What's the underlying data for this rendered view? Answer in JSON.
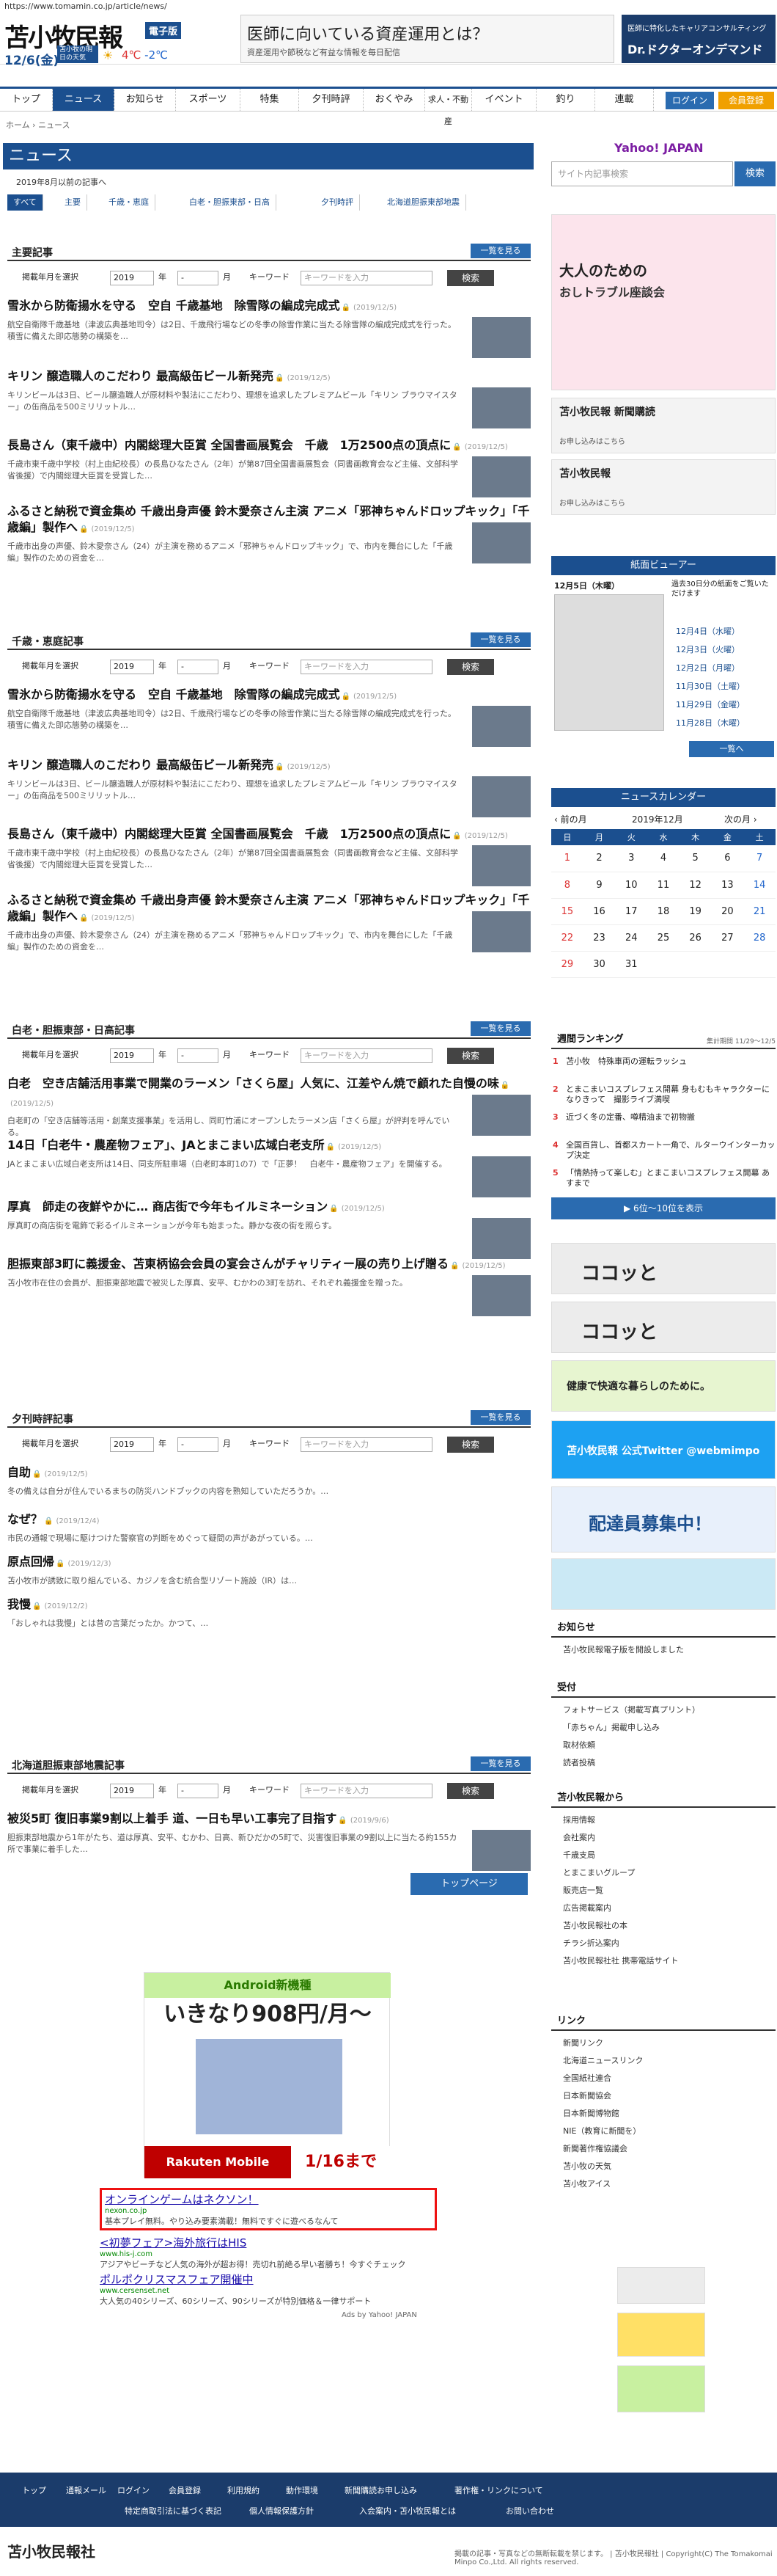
{
  "url": "https://www.tomamin.co.jp/article/news/",
  "header": {
    "logo": "苫小牧民報",
    "logo_tag": "電子版",
    "date": "12/6(金)",
    "weather_label": "苫小牧の明日の天気",
    "temp_hi": "4℃",
    "temp_lo": "-2℃",
    "ad_title": "医師に向いている資産運用とは？",
    "ad_sub": "資産運用や節税など有益な情報を毎日配信",
    "side_ad_1": "医師に特化したキャリアコンサルティング",
    "side_ad_2": "Dr.ドクターオンデマンド"
  },
  "nav": {
    "items": [
      "トップ",
      "ニュース",
      "お知らせ",
      "スポーツ",
      "特集",
      "夕刊時評",
      "おくやみ",
      "求人・不動産",
      "イベント",
      "釣り",
      "連載"
    ],
    "login": "ログイン",
    "member": "会員登録"
  },
  "breadcrumb": "ホーム › ニュース",
  "main": {
    "title": "ニュース",
    "archive": "2019年8月以前の記事へ",
    "tabs": [
      "すべて",
      "主要",
      "千歳・恵庭",
      "白老・胆振東部・日高",
      "夕刊時評",
      "北海道胆振東部地震"
    ],
    "filter": {
      "label": "掲載年月を選択",
      "year": "2019",
      "year_u": "年",
      "month": "-",
      "month_u": "月",
      "kw_label": "キーワード",
      "kw_ph": "キーワードを入力",
      "go": "検索"
    },
    "more": "一覧を見る",
    "sections": [
      {
        "title": "主要記事",
        "articles": [
          {
            "h": "雪氷から防衛揚水を守る　空自 千歳基地　除雪隊の編成完成式",
            "d": "(2019/12/5)",
            "s": "航空自衛隊千歳基地（津波広典基地司令）は2日、千歳飛行場などの冬季の除雪作業に当たる除雪隊の編成完成式を行った。積雪に備えた即応態勢の構築を…"
          },
          {
            "h": "キリン 醸造職人のこだわり 最高級缶ビール新発売",
            "d": "(2019/12/5)",
            "s": "キリンビールは3日、ビール醸造職人が原材料や製法にこだわり、理想を追求したプレミアムビール「キリン ブラウマイスター」の缶商品を500ミリリットル…"
          },
          {
            "h": "長島さん（東千歳中）内閣総理大臣賞 全国書画展覧会　千歳　1万2500点の頂点に",
            "d": "(2019/12/5)",
            "s": "千歳市東千歳中学校（村上由紀校長）の長島ひなたさん（2年）が第87回全国書画展覧会（同書画教育会など主催、文部科学省後援）で内閣総理大臣賞を受賞した…"
          },
          {
            "h": "ふるさと納税で資金集め 千歳出身声優 鈴木愛奈さん主演 アニメ「邪神ちゃんドロップキック」「千歳編」製作へ",
            "d": "(2019/12/5)",
            "s": "千歳市出身の声優、鈴木愛奈さん（24）が主演を務めるアニメ「邪神ちゃんドロップキック」で、市内を舞台にした「千歳編」製作のための資金を…"
          }
        ]
      },
      {
        "title": "千歳・恵庭記事",
        "articles": [
          {
            "h": "雪氷から防衛揚水を守る　空自 千歳基地　除雪隊の編成完成式",
            "d": "(2019/12/5)",
            "s": "航空自衛隊千歳基地（津波広典基地司令）は2日、千歳飛行場などの冬季の除雪作業に当たる除雪隊の編成完成式を行った。積雪に備えた即応態勢の構築を…"
          },
          {
            "h": "キリン 醸造職人のこだわり 最高級缶ビール新発売",
            "d": "(2019/12/5)",
            "s": "キリンビールは3日、ビール醸造職人が原材料や製法にこだわり、理想を追求したプレミアムビール「キリン ブラウマイスター」の缶商品を500ミリリットル…"
          },
          {
            "h": "長島さん（東千歳中）内閣総理大臣賞 全国書画展覧会　千歳　1万2500点の頂点に",
            "d": "(2019/12/5)",
            "s": "千歳市東千歳中学校（村上由紀校長）の長島ひなたさん（2年）が第87回全国書画展覧会（同書画教育会など主催、文部科学省後援）で内閣総理大臣賞を受賞した…"
          },
          {
            "h": "ふるさと納税で資金集め 千歳出身声優 鈴木愛奈さん主演 アニメ「邪神ちゃんドロップキック」「千歳編」製作へ",
            "d": "(2019/12/5)",
            "s": "千歳市出身の声優、鈴木愛奈さん（24）が主演を務めるアニメ「邪神ちゃんドロップキック」で、市内を舞台にした「千歳編」製作のための資金を…"
          }
        ]
      },
      {
        "title": "白老・胆振東部・日高記事",
        "articles": [
          {
            "h": "白老　空き店舗活用事業で開業のラーメン「さくら屋」人気に、江差やん焼で顧れた自慢の味",
            "d": "(2019/12/5)",
            "s": "白老町の「空き店舗等活用・創業支援事業」を活用し、同町竹浦にオープンしたラーメン店「さくら屋」が評判を呼んでいる。"
          },
          {
            "h": "14日「白老牛・農産物フェア」、JAとまこまい広域白老支所",
            "d": "(2019/12/5)",
            "s": "JAとまこまい広域白老支所は14日、同支所駐車場（白老町本町1の7）で「正夢！　白老牛・農産物フェア」を開催する。"
          },
          {
            "h": "厚真　師走の夜鮮やかに… 商店街で今年もイルミネーション",
            "d": "(2019/12/5)",
            "s": "厚真町の商店街を電飾で彩るイルミネーションが今年も始まった。静かな夜の街を照らす。"
          },
          {
            "h": "胆振東部3町に義援金、苫東柄協会会員の宴会さんがチャリティー展の売り上げ贈る",
            "d": "(2019/12/5)",
            "s": "苫小牧市在住の会員が、胆振東部地震で被災した厚真、安平、むかわの3町を訪れ、それぞれ義援金を贈った。"
          }
        ]
      },
      {
        "title": "夕刊時評記事",
        "articles": [
          {
            "h": "自助",
            "d": "(2019/12/5)",
            "s": "冬の備えは自分が住んでいるまちの防災ハンドブックの内容を熟知していただろうか。…"
          },
          {
            "h": "なぜ？",
            "d": "(2019/12/4)",
            "s": "市民の通報で現場に駆けつけた警察官の判断をめぐって疑問の声があがっている。…"
          },
          {
            "h": "原点回帰",
            "d": "(2019/12/3)",
            "s": "苫小牧市が誘致に取り組んでいる、カジノを含む統合型リゾート施設（IR）は…"
          },
          {
            "h": "我慢",
            "d": "(2019/12/2)",
            "s": "「おしゃれは我慢」とは昔の言葉だったか。かつて、…"
          }
        ]
      },
      {
        "title": "北海道胆振東部地震記事",
        "articles": [
          {
            "h": "被災5町 復旧事業9割以上着手 道、一日も早い工事完了目指す",
            "d": "(2019/9/6)",
            "s": "胆振東部地震から1年がたち、道は厚真、安平、むかわ、日高、新ひだかの5町で、災害復旧事業の9割以上に当たる約155カ所で事業に着手した…"
          }
        ]
      }
    ],
    "top_btn": "トップページ"
  },
  "sidebar": {
    "yahoo": "Yahoo! JAPAN",
    "search_ph": "サイト内記事検索",
    "search_btn": "検索",
    "promo1": {
      "t1": "大人のための",
      "t2": "おしトラブル座談会"
    },
    "promo2": {
      "t1": "苫小牧民報 新聞購読",
      "t2": "お申し込みはこちら"
    },
    "promo3": {
      "t1": "苫小牧民報",
      "t2": "お申し込みはこちら"
    },
    "viewer": {
      "head": "紙面ビューアー",
      "date": "12月5日（木曜）",
      "note": "過去30日分の紙面をご覧いただけます",
      "dates": [
        "12月4日（水曜）",
        "12月3日（火曜）",
        "12月2日（月曜）",
        "11月30日（土曜）",
        "11月29日（金曜）",
        "11月28日（木曜）"
      ],
      "btn": "一覧へ"
    },
    "calendar": {
      "head": "ニュースカレンダー",
      "prev": "‹ 前の月",
      "title": "2019年12月",
      "next": "次の月 ›",
      "dow": [
        "日",
        "月",
        "火",
        "水",
        "木",
        "金",
        "土"
      ],
      "weeks": [
        [
          "1",
          "2",
          "3",
          "4",
          "5",
          "6",
          "7"
        ],
        [
          "8",
          "9",
          "10",
          "11",
          "12",
          "13",
          "14"
        ],
        [
          "15",
          "16",
          "17",
          "18",
          "19",
          "20",
          "21"
        ],
        [
          "22",
          "23",
          "24",
          "25",
          "26",
          "27",
          "28"
        ],
        [
          "29",
          "30",
          "31",
          "",
          "",
          "",
          "",
          ""
        ]
      ]
    },
    "ranking": {
      "head": "週間ランキング",
      "period": "集計期間 11/29〜12/5",
      "items": [
        "苫小牧　特殊車両の運転ラッシュ",
        "とまこまいコスプレフェス開幕 身もむもキャラクターになりきって　撮影ライブ満喫",
        "近づく冬の定番、噂精油まで初物搬",
        "全国百貨し、首都スカート一角で、ルターウインターカップ決定",
        "「情熱持って楽しむ」とまこまいコスプレフェス開幕 あすまで"
      ],
      "more": "▶ 6位〜10位を表示"
    },
    "ad_cocotto": "ココッと",
    "ad_medical": "健康で快適な暮らしのために。",
    "twitter": "苫小牧民報 公式Twitter @webmimpo",
    "recruit": "配達員募集中！",
    "info_head": "お知らせ",
    "info_items": [
      "苫小牧民報電子版を開設しました"
    ],
    "accept_head": "受付",
    "accept_items": [
      "フォトサービス（掲載写真プリント）",
      "「赤ちゃん」掲載申し込み",
      "取材依頼",
      "読者投稿"
    ],
    "from_head": "苫小牧民報から",
    "from_items": [
      "採用情報",
      "会社案内",
      "千歳支局",
      "とまこまいグループ",
      "販売店一覧",
      "広告掲載案内",
      "苫小牧民報社の本",
      "チラシ折込案内",
      "苫小牧民報社社 携帯電話サイト"
    ],
    "link_head": "リンク",
    "link_items": [
      "新聞リンク",
      "北海道ニュースリンク",
      "全国紙社連合",
      "日本新聞協会",
      "日本新聞博物館",
      "NIE（教育に新聞を）",
      "新聞著作権協議会",
      "苫小牧の天気",
      "苫小牧アイス"
    ]
  },
  "ads": {
    "main_title": "Android新機種",
    "main_price": "いきなり908円/月〜",
    "main_brand": "Rakuten Mobile",
    "main_date": "1/16まで",
    "text": [
      {
        "l1": "オンラインゲームはネクソン！",
        "l2": "nexon.co.jp",
        "l3": "基本プレイ無料。やり込み要素満載！無料ですぐに遊べるなんて"
      },
      {
        "l1": "<初夢フェア>海外旅行はHIS",
        "l2": "www.his-j.com",
        "l3": "アジアやビーチなど人気の海外が超お得！売切れ前絶る早い者勝ち！今すぐチェック"
      },
      {
        "l1": "ポルポクリスマスフェア開催中",
        "l2": "www.cersenset.net",
        "l3": "大人気の40シリーズ、60シリーズ、90シリーズが特別価格＆一律サポート"
      }
    ],
    "by": "Ads by Yahoo! JAPAN"
  },
  "footer": {
    "row1": [
      "トップ",
      "通報メール",
      "ログイン",
      "会員登録",
      "利用規約",
      "動作環境",
      "新聞購読お申し込み",
      "著作権・リンクについて"
    ],
    "row2": [
      "特定商取引法に基づく表記",
      "個人情報保護方針",
      "入会案内・苫小牧民報とは",
      "お問い合わせ"
    ],
    "logo": "苫小牧民報社",
    "copy": "掲載の記事・写真などの無断転載を禁じます。 | 苫小牧民報社 | Copyright(C) The Tomakomai Minpo Co.,Ltd. All rights reserved."
  }
}
